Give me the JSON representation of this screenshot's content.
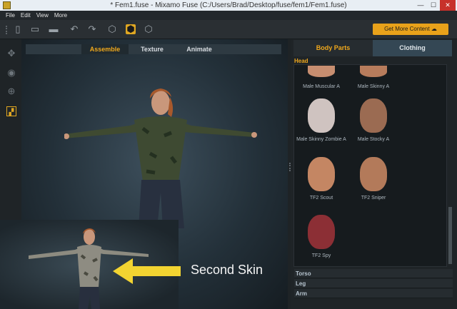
{
  "window": {
    "title": "* Fem1.fuse - Mixamo Fuse (C:/Users/Brad/Desktop/fuse/fem1/Fem1.fuse)"
  },
  "menu": [
    "File",
    "Edit",
    "View",
    "More"
  ],
  "toolbar": {
    "get_more_label": "Get More Content",
    "accent": "#e9a21a"
  },
  "mode_tabs": [
    "Assemble",
    "Texture",
    "Animate"
  ],
  "panel_tabs": {
    "body_parts": "Body Parts",
    "clothing": "Clothing"
  },
  "section": {
    "head": "Head"
  },
  "thumbnails": [
    {
      "label": "Male Muscular A",
      "skin": "#c78e70"
    },
    {
      "label": "Male Skinny A",
      "skin": "#b77c5c"
    },
    {
      "label": "Male Skinny Zombie A",
      "skin": "#cfc3c0"
    },
    {
      "label": "Male Stocky A",
      "skin": "#9b6b52"
    },
    {
      "label": "TF2 Scout",
      "skin": "#c48663"
    },
    {
      "label": "TF2 Sniper",
      "skin": "#b37a5a"
    },
    {
      "label": "TF2 Spy",
      "skin": "#8c2f35"
    }
  ],
  "collapsed_sections": [
    "Torso",
    "Leg",
    "Arm"
  ],
  "callout": {
    "text": "Second Skin"
  }
}
